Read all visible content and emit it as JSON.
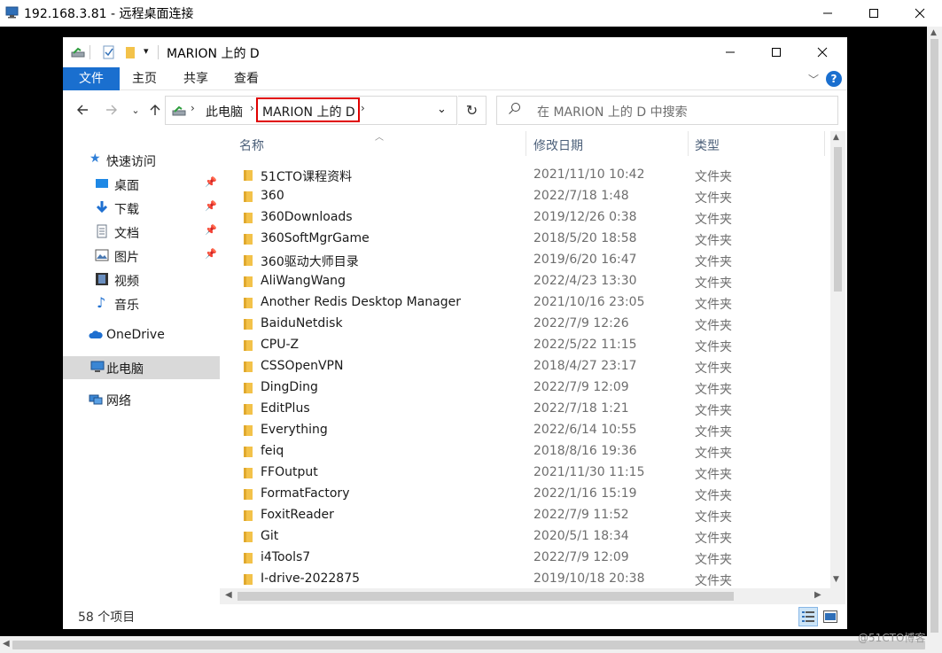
{
  "rdp_window": {
    "title": "192.168.3.81 - 远程桌面连接"
  },
  "explorer": {
    "title": "MARION 上的 D",
    "ribbon_tabs": [
      "文件",
      "主页",
      "共享",
      "查看"
    ],
    "breadcrumb": [
      "此电脑",
      "MARION 上的 D"
    ],
    "search_placeholder": "在 MARION 上的 D 中搜索",
    "nav_pane": {
      "quick_access": "快速访问",
      "pinned": [
        "桌面",
        "下载",
        "文档",
        "图片"
      ],
      "others": [
        "视频",
        "音乐"
      ],
      "onedrive": "OneDrive",
      "this_pc": "此电脑",
      "network": "网络"
    },
    "columns": [
      "名称",
      "修改日期",
      "类型"
    ],
    "files": [
      {
        "name": "51CTO课程资料",
        "date": "2021/11/10 10:42",
        "type": "文件夹"
      },
      {
        "name": "360",
        "date": "2022/7/18 1:48",
        "type": "文件夹"
      },
      {
        "name": "360Downloads",
        "date": "2019/12/26 0:38",
        "type": "文件夹"
      },
      {
        "name": "360SoftMgrGame",
        "date": "2018/5/20 18:58",
        "type": "文件夹"
      },
      {
        "name": "360驱动大师目录",
        "date": "2019/6/20 16:47",
        "type": "文件夹"
      },
      {
        "name": "AliWangWang",
        "date": "2022/4/23 13:30",
        "type": "文件夹"
      },
      {
        "name": "Another Redis Desktop Manager",
        "date": "2021/10/16 23:05",
        "type": "文件夹"
      },
      {
        "name": "BaiduNetdisk",
        "date": "2022/7/9 12:26",
        "type": "文件夹"
      },
      {
        "name": "CPU-Z",
        "date": "2022/5/22 11:15",
        "type": "文件夹"
      },
      {
        "name": "CSSOpenVPN",
        "date": "2018/4/27 23:17",
        "type": "文件夹"
      },
      {
        "name": "DingDing",
        "date": "2022/7/9 12:09",
        "type": "文件夹"
      },
      {
        "name": "EditPlus",
        "date": "2022/7/18 1:21",
        "type": "文件夹"
      },
      {
        "name": "Everything",
        "date": "2022/6/14 10:55",
        "type": "文件夹"
      },
      {
        "name": "feiq",
        "date": "2018/8/16 19:36",
        "type": "文件夹"
      },
      {
        "name": "FFOutput",
        "date": "2021/11/30 11:15",
        "type": "文件夹"
      },
      {
        "name": "FormatFactory",
        "date": "2022/1/16 15:19",
        "type": "文件夹"
      },
      {
        "name": "FoxitReader",
        "date": "2022/7/9 11:52",
        "type": "文件夹"
      },
      {
        "name": "Git",
        "date": "2020/5/1 18:34",
        "type": "文件夹"
      },
      {
        "name": "i4Tools7",
        "date": "2022/7/9 12:09",
        "type": "文件夹"
      },
      {
        "name": "I-drive-2022875",
        "date": "2019/10/18 20:38",
        "type": "文件夹"
      }
    ],
    "status_count": "58 个项目"
  },
  "watermark": "@51CTO博客",
  "colors": {
    "accent": "#1a6fcf",
    "highlight_box": "#e00000",
    "folder": "#f3c24a"
  }
}
